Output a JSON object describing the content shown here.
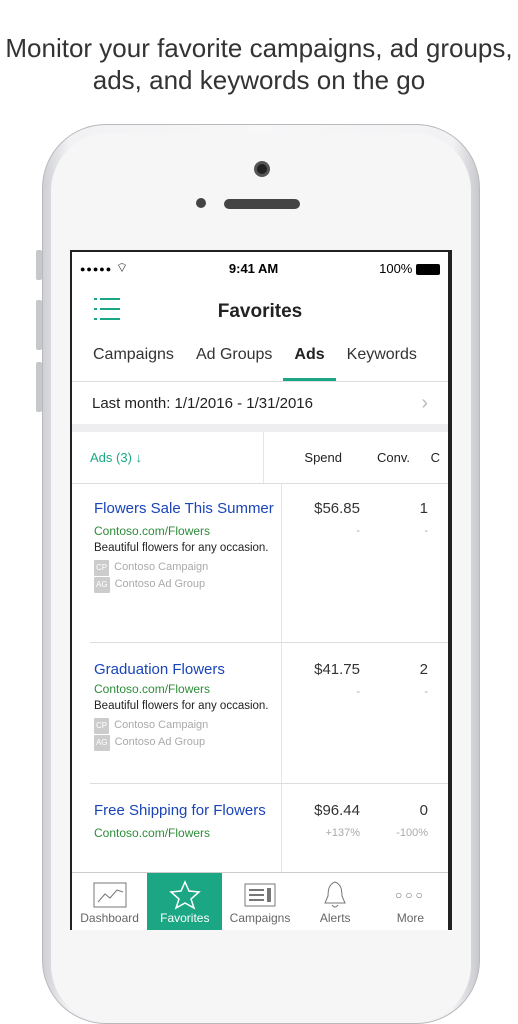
{
  "headline": "Monitor your favorite campaigns, ad groups, ads, and keywords on the go",
  "status": {
    "signal": "●●●●●",
    "time": "9:41 AM",
    "battery": "100%"
  },
  "nav": {
    "title": "Favorites"
  },
  "tabs": [
    {
      "label": "Campaigns"
    },
    {
      "label": "Ad Groups"
    },
    {
      "label": "Ads",
      "active": true
    },
    {
      "label": "Keywords"
    }
  ],
  "date_range": "Last month: 1/1/2016 - 1/31/2016",
  "table": {
    "headers": {
      "name": "Ads (3)",
      "spend": "Spend",
      "conv": "Conv.",
      "next": "C"
    },
    "rows": [
      {
        "title": "Flowers Sale This Summer",
        "url": "Contoso.com/Flowers",
        "desc": "Beautiful flowers for any occasion.",
        "cp_tag": "CP",
        "campaign": "Contoso Campaign",
        "ag_tag": "AG",
        "ad_group": "Contoso Ad Group",
        "spend": "$56.85",
        "spend_change": "-",
        "conv": "1",
        "conv_change": "-"
      },
      {
        "title": "Graduation Flowers",
        "url": "Contoso.com/Flowers",
        "desc": "Beautiful flowers for any occasion.",
        "cp_tag": "CP",
        "campaign": "Contoso Campaign",
        "ag_tag": "AG",
        "ad_group": "Contoso Ad Group",
        "spend": "$41.75",
        "spend_change": "-",
        "conv": "2",
        "conv_change": "-"
      },
      {
        "title": "Free Shipping for Flowers",
        "url": "Contoso.com/Flowers",
        "spend": "$96.44",
        "spend_change": "+137%",
        "conv": "0",
        "conv_change": "-100%"
      }
    ]
  },
  "tabbar": [
    {
      "label": "Dashboard",
      "icon": "chart-icon"
    },
    {
      "label": "Favorites",
      "icon": "star-icon",
      "active": true
    },
    {
      "label": "Campaigns",
      "icon": "campaigns-icon"
    },
    {
      "label": "Alerts",
      "icon": "bell-icon"
    },
    {
      "label": "More",
      "icon": "more-icon"
    }
  ],
  "colors": {
    "accent": "#1ba784",
    "link": "#1a44b8",
    "url": "#2e8b3a"
  }
}
